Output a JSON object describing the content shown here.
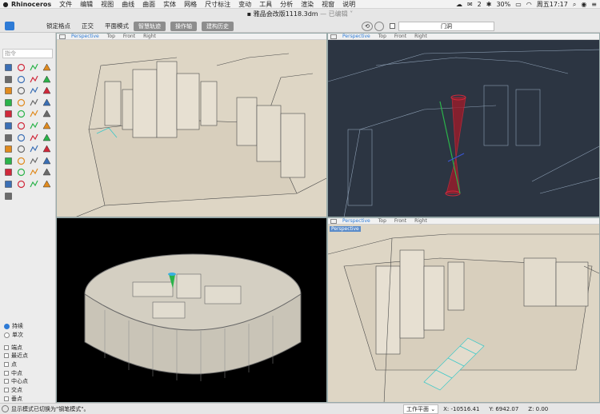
{
  "menubar": {
    "app_name": "Rhinoceros",
    "items": [
      "文件",
      "编辑",
      "视图",
      "曲线",
      "曲面",
      "实体",
      "网格",
      "尺寸标注",
      "变动",
      "工具",
      "分析",
      "渲染",
      "视窗",
      "说明"
    ],
    "battery": "30%",
    "notifications": "2",
    "clock": "周五17:17"
  },
  "titlebar": {
    "filename": "雅品会改版1118.3dm",
    "status": " — 已编辑 ˅"
  },
  "toolbar": {
    "buttons": [
      "锁定格点",
      "正交",
      "平面模式"
    ],
    "pills": [
      "智慧轨迹",
      "操作轴",
      "建构历史"
    ],
    "layer_name": "门洞"
  },
  "left_panel": {
    "command_placeholder": "指令",
    "osnap": {
      "modes": [
        {
          "label": "持续",
          "on": true
        },
        {
          "label": "单次",
          "on": false
        }
      ],
      "snaps": [
        "端点",
        "最近点",
        "点",
        "中点",
        "中心点",
        "交点",
        "垂点",
        "切点"
      ]
    }
  },
  "viewports": {
    "tl": {
      "tabs": [
        "Perspective",
        "Top",
        "Front",
        "Right"
      ],
      "active": 0
    },
    "tr": {
      "tabs": [
        "Perspective",
        "Top",
        "Front",
        "Right"
      ],
      "active": 0
    },
    "bl": {
      "tabs": [],
      "active": -1
    },
    "br": {
      "tabs": [
        "Perspective",
        "Top",
        "Front",
        "Right"
      ],
      "active": 0,
      "label": "Perspective"
    }
  },
  "statusbar": {
    "message": "显示模式已切换为\"钢笔模式\"。",
    "cplane": "工作平面 ⌄",
    "x": "X: -10516.41",
    "y": "Y: 6942.07",
    "z": "Z: 0.00"
  },
  "colors": {
    "accent": "#2e7bd6",
    "pen_bg": "#ded6c5",
    "dark_bg": "#2c3542",
    "gumball_red": "#d0283a",
    "gumball_green": "#2bb34a",
    "gumball_blue": "#3a55d0"
  }
}
